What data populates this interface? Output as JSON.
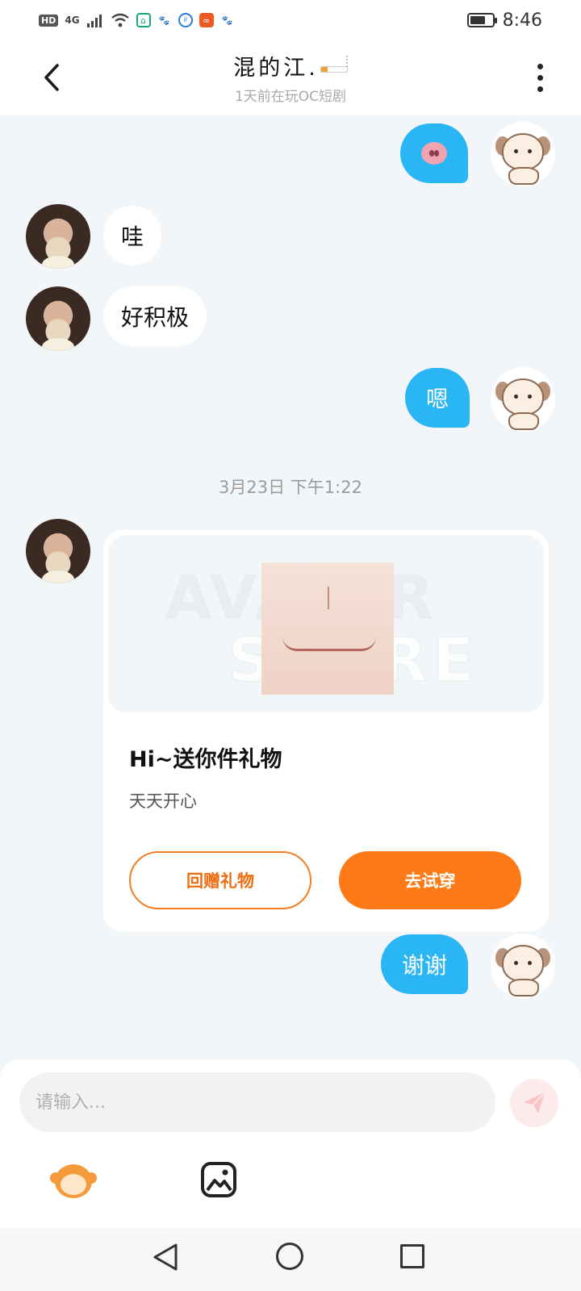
{
  "status_bar": {
    "hd": "HD",
    "network": "4G",
    "time": "8:46",
    "battery_level": 0.7,
    "icons": [
      "hd-icon",
      "signal-icon",
      "wifi-icon",
      "home-app-icon",
      "baidu-icon",
      "ifly-icon",
      "app-icon",
      "baidu-icon"
    ]
  },
  "header": {
    "title": "混的江.",
    "subtitle": "1天前在玩OC短剧",
    "back_icon": "chevron-left-icon",
    "more_icon": "more-vertical-icon"
  },
  "messages": [
    {
      "side": "right",
      "type": "emoji",
      "content": "pig-nose-emoji"
    },
    {
      "side": "left",
      "type": "text",
      "content": "哇"
    },
    {
      "side": "left",
      "type": "text",
      "content": "好积极"
    },
    {
      "side": "right",
      "type": "text",
      "content": "嗯"
    },
    {
      "type": "timestamp",
      "content": "3月23日 下午1:22"
    },
    {
      "side": "left",
      "type": "gift_card"
    },
    {
      "side": "right",
      "type": "text",
      "content": "谢谢"
    }
  ],
  "timestamp": "3月23日 下午1:22",
  "gift_card": {
    "watermark_line1": "AVATAR",
    "watermark_line2": "STORE",
    "title": "Hi~送你件礼物",
    "description": "天天开心",
    "return_button": "回赠礼物",
    "try_button": "去试穿"
  },
  "input": {
    "placeholder": "请输入...",
    "value": "",
    "send_icon": "send-icon",
    "sticker_icon": "monkey-sticker-icon",
    "image_icon": "image-icon"
  },
  "colors": {
    "bubble_self": "#2ab5f5",
    "bubble_other": "#ffffff",
    "accent_orange": "#fe7a16",
    "background": "#f3f6f9"
  }
}
